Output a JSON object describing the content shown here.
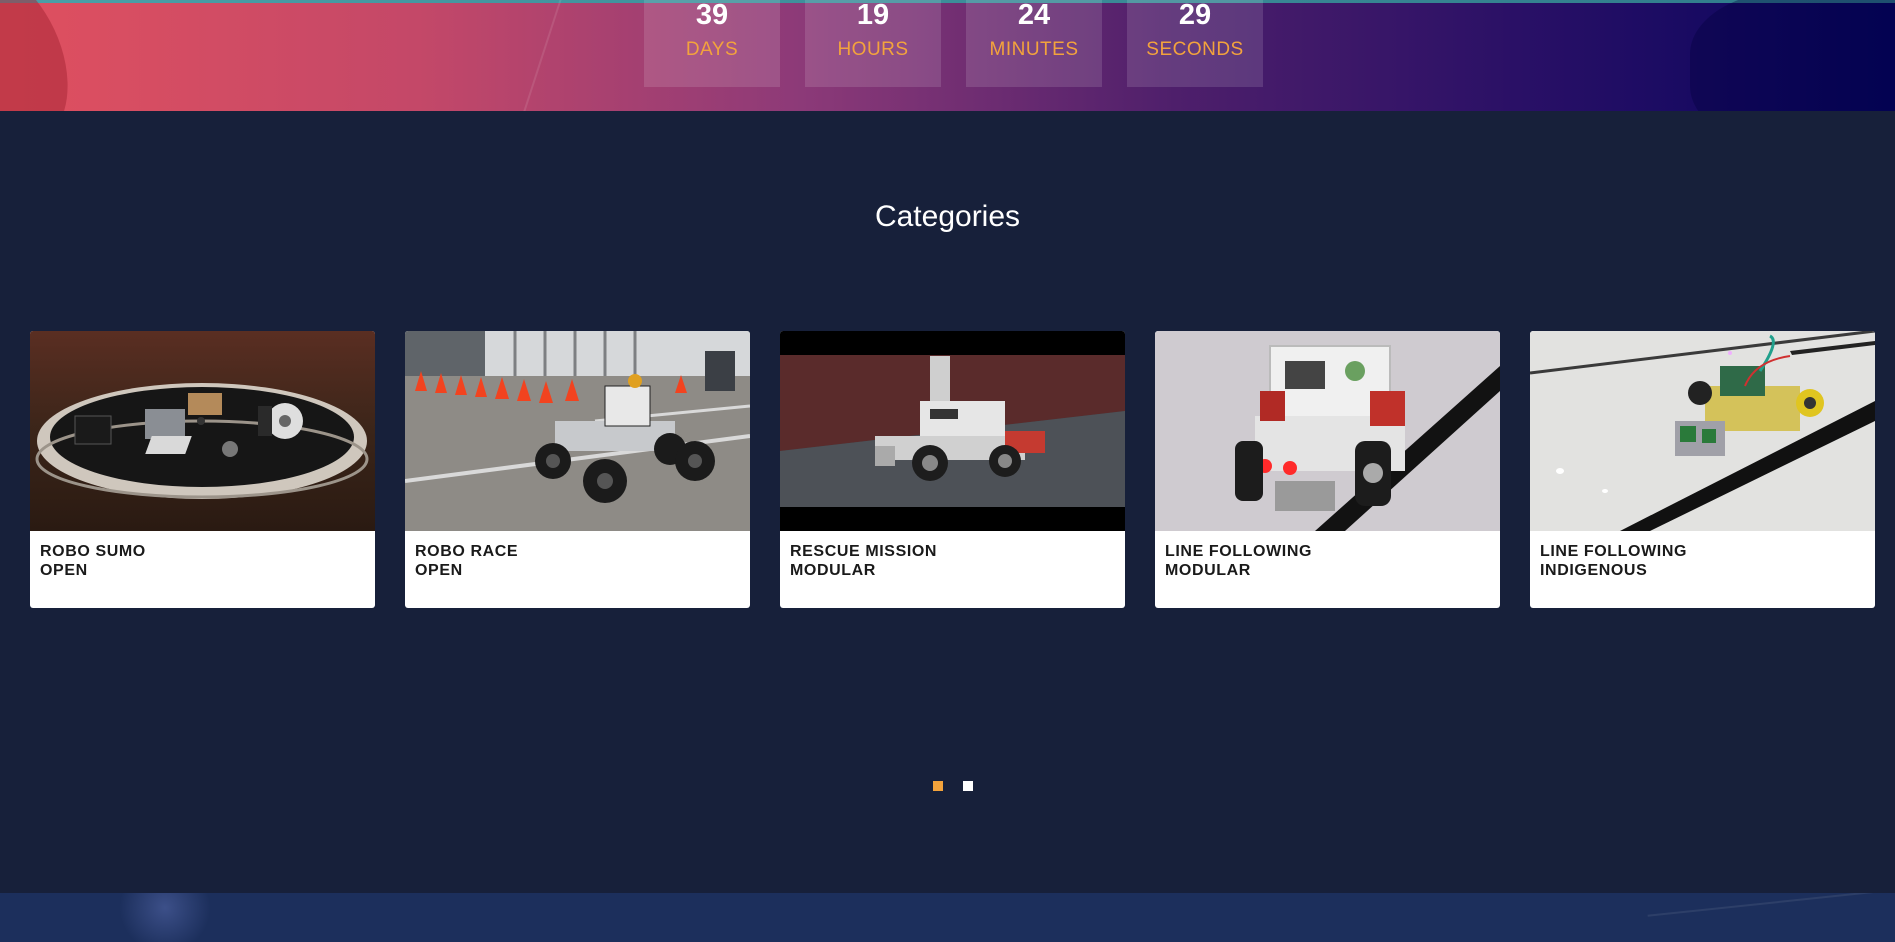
{
  "countdown": [
    {
      "value": "39",
      "label": "DAYS"
    },
    {
      "value": "19",
      "label": "HOURS"
    },
    {
      "value": "24",
      "label": "MINUTES"
    },
    {
      "value": "29",
      "label": "SECONDS"
    }
  ],
  "categories": {
    "title": "Categories",
    "items": [
      {
        "line1": "ROBO SUMO",
        "line2": "OPEN",
        "image": "robo-sumo-image"
      },
      {
        "line1": "ROBO RACE",
        "line2": "OPEN",
        "image": "robo-race-image"
      },
      {
        "line1": "RESCUE MISSION",
        "line2": "MODULAR",
        "image": "rescue-mission-image"
      },
      {
        "line1": "LINE FOLLOWING",
        "line2": "MODULAR",
        "image": "line-following-modular-image"
      },
      {
        "line1": "LINE FOLLOWING",
        "line2": "INDIGENOUS",
        "image": "line-following-indigenous-image"
      }
    ]
  },
  "pager": {
    "pages": 2,
    "active": 1,
    "active_color": "#f3a33c",
    "inactive_color": "#ffffff"
  },
  "colors": {
    "page_bg": "#17203a",
    "accent": "#f3a33c",
    "card_bg": "#ffffff"
  }
}
